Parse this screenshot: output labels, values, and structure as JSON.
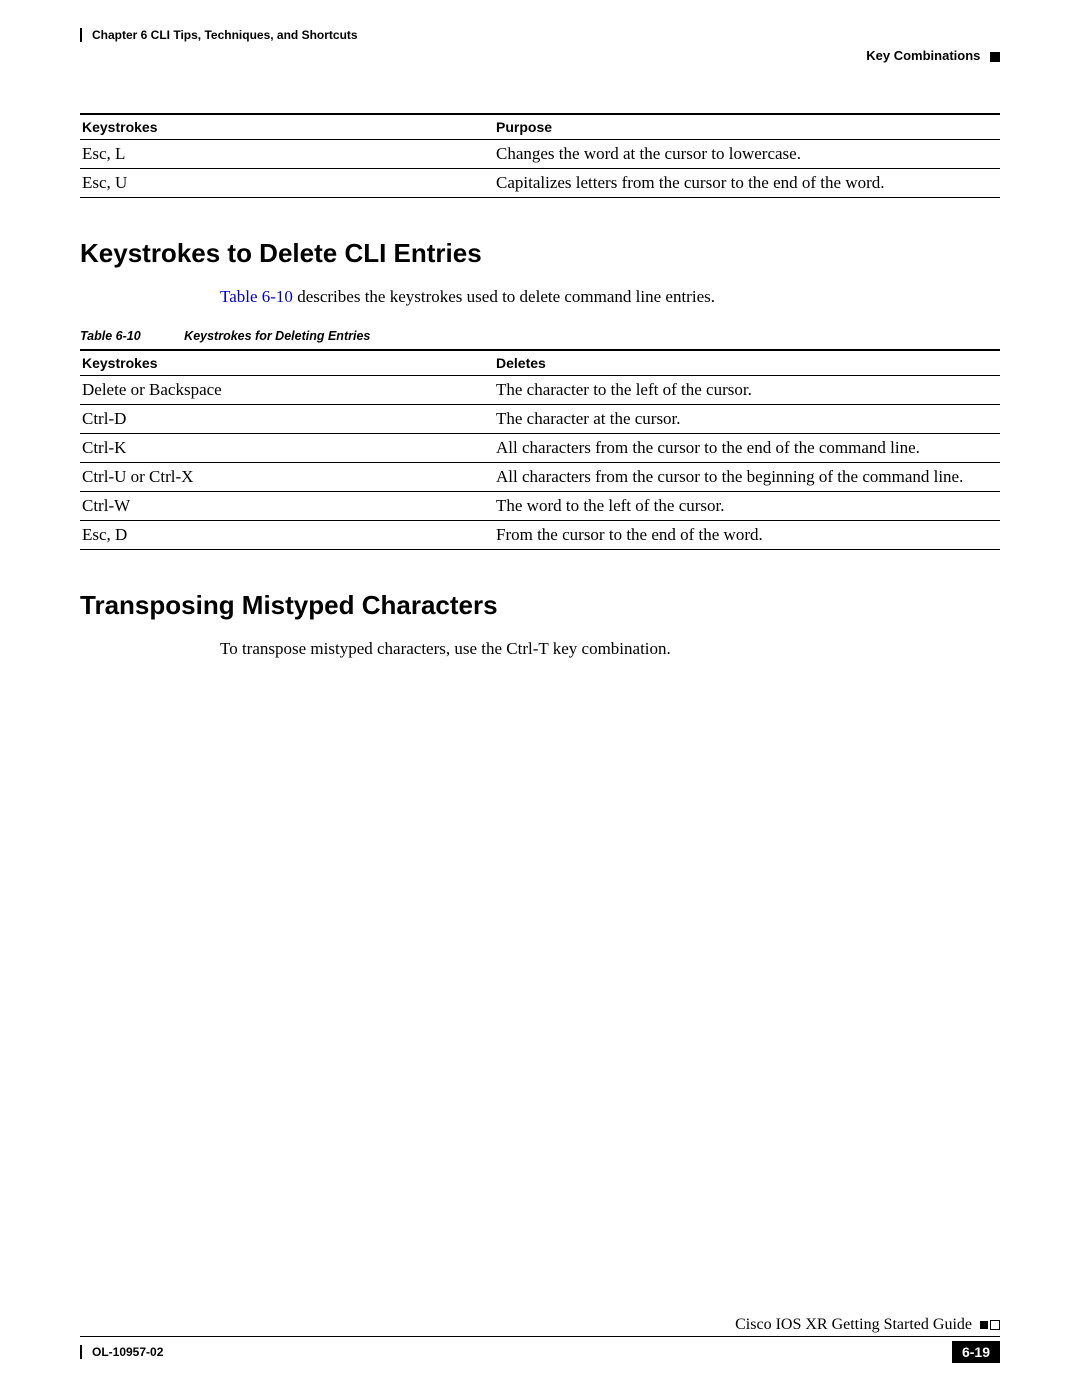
{
  "header": {
    "chapter_line": "Chapter 6    CLI Tips, Techniques, and Shortcuts",
    "section": "Key Combinations"
  },
  "table1": {
    "head": {
      "col1": "Keystrokes",
      "col2": "Purpose"
    },
    "rows": [
      {
        "k": "Esc, L",
        "p": "Changes the word at the cursor to lowercase."
      },
      {
        "k": "Esc, U",
        "p": "Capitalizes letters from the cursor to the end of the word."
      }
    ]
  },
  "section1": {
    "title": "Keystrokes to Delete CLI Entries",
    "intro_pre": "",
    "intro_link": "Table 6-10",
    "intro_post": " describes the keystrokes used to delete command line entries.",
    "caption_num": "Table 6-10",
    "caption_text": "Keystrokes for Deleting Entries",
    "head": {
      "col1": "Keystrokes",
      "col2": "Deletes"
    },
    "rows": [
      {
        "k": "Delete or Backspace",
        "p": "The character to the left of the cursor."
      },
      {
        "k": "Ctrl-D",
        "p": "The character at the cursor."
      },
      {
        "k": "Ctrl-K",
        "p": "All characters from the cursor to the end of the command line."
      },
      {
        "k": "Ctrl-U or Ctrl-X",
        "p": "All characters from the cursor to the beginning of the command line."
      },
      {
        "k": "Ctrl-W",
        "p": "The word to the left of the cursor."
      },
      {
        "k": "Esc, D",
        "p": "From the cursor to the end of the word."
      }
    ]
  },
  "section2": {
    "title": "Transposing Mistyped Characters",
    "body": "To transpose mistyped characters, use the Ctrl-T key combination."
  },
  "footer": {
    "doc_id": "OL-10957-02",
    "guide": "Cisco IOS XR Getting Started Guide",
    "page": "6-19"
  }
}
